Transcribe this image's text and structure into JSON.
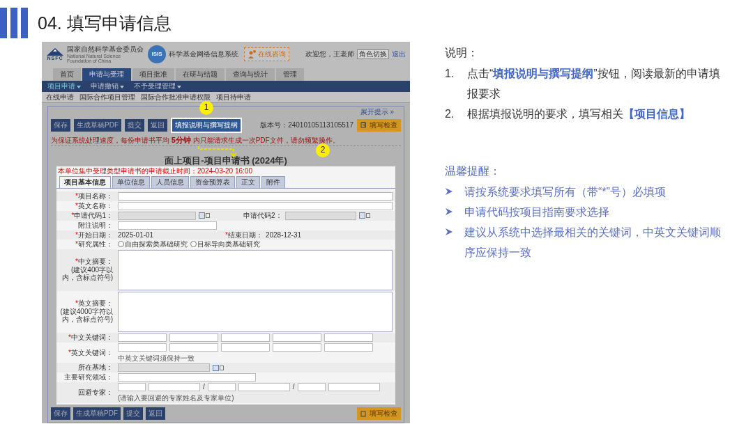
{
  "slide": {
    "title": "04. 填写申请信息"
  },
  "screenshot": {
    "header": {
      "logo_letters": "NSFC",
      "org_name": "国家自然科学基金委员会",
      "org_name_en": "National Natural Science Foundation of China",
      "system_badge": "ISIS",
      "system_name": "科学基金网络信息系统",
      "consult_button": "在线咨询",
      "welcome": "欢迎您，王老师",
      "role_select": "角色切换",
      "logout": "退出"
    },
    "main_tabs": [
      {
        "label": "首页",
        "selected": false
      },
      {
        "label": "申请与受理",
        "selected": true
      },
      {
        "label": "项目批准",
        "selected": false
      },
      {
        "label": "在研与结题",
        "selected": false
      },
      {
        "label": "查询与统计",
        "selected": false
      },
      {
        "label": "管理",
        "selected": false
      }
    ],
    "menu": [
      {
        "label": "项目申请",
        "selected": true
      },
      {
        "label": "申请撤销",
        "selected": false
      },
      {
        "label": "不予受理管理",
        "selected": false
      }
    ],
    "submenu": [
      "在线申请",
      "国际合作项目管理",
      "国际合作批准申请权限",
      "项目待申请"
    ],
    "hint_toggle": "展开提示 »",
    "toolbar": {
      "buttons": [
        {
          "label": "保存",
          "highlighted": false
        },
        {
          "label": "生成草稿PDF",
          "highlighted": false
        },
        {
          "label": "提交",
          "highlighted": false
        },
        {
          "label": "返回",
          "highlighted": false
        },
        {
          "label": "填报说明与撰写提纲",
          "highlighted": true
        }
      ],
      "version": "版本号：24010105113105517",
      "check_button": "填写检查"
    },
    "warning": "为保证系统处理速度，每份申请书平均 **5分钟** 内只能请求生成一次PDF文件，请勿频繁操作。",
    "form_title": "面上项目-项目申请书 (2024年)",
    "deadline": "本单位集中受理类型申请书的申请截止时间：2024-03-20 16:00",
    "form_tabs": [
      {
        "label": "项目基本信息",
        "selected": true
      },
      {
        "label": "单位信息",
        "selected": false
      },
      {
        "label": "人员信息",
        "selected": false
      },
      {
        "label": "资金预算表",
        "selected": false
      },
      {
        "label": "正文",
        "selected": false
      },
      {
        "label": "附件",
        "selected": false
      }
    ],
    "fields": [
      {
        "kind": "text",
        "mark": "*",
        "label": "项目名称："
      },
      {
        "kind": "text",
        "mark": "*",
        "label": "英文名称："
      },
      {
        "kind": "code_pair",
        "mark": "*",
        "label": "申请代码1：",
        "label2": "申请代码2："
      },
      {
        "kind": "select",
        "label": "附注说明："
      },
      {
        "kind": "date_pair",
        "mark": "*",
        "label": "开始日期：",
        "value": "2025-01-01",
        "mark2": "*",
        "label2": "结束日期：",
        "value2": "2028-12-31"
      },
      {
        "kind": "radio",
        "mark": "*",
        "label": "研究属性：",
        "options": [
          {
            "label": "自由探索类基础研究",
            "selected": false
          },
          {
            "label": "目标导向类基础研究",
            "selected": false
          }
        ]
      },
      {
        "kind": "textarea",
        "mark": "*",
        "label": "中文摘要：",
        "note": "(建议400字以内，含标点符号)"
      },
      {
        "kind": "textarea",
        "mark": "*",
        "label": "英文摘要：",
        "note": "(建议4000字符以内，含标点符号)"
      },
      {
        "kind": "keywords",
        "mark": "*",
        "label": "中文关键词："
      },
      {
        "kind": "keywords",
        "mark": "*",
        "label": "英文关键词：",
        "note": "中英文关键词须保持一致"
      },
      {
        "kind": "picker",
        "label": "所在基地："
      },
      {
        "kind": "short_text",
        "label": "主要研究领域："
      },
      {
        "kind": "experts",
        "label": "回避专家：",
        "separator": "/",
        "note": "(请输入要回避的专家姓名及专家单位)"
      }
    ],
    "bottom_buttons": [
      "保存",
      "生成草稿PDF",
      "提交",
      "返回"
    ],
    "bottom_check_button": "填写检查",
    "callouts": [
      "1",
      "2"
    ]
  },
  "notes": {
    "title": "说明：",
    "steps": [
      {
        "number": "1.",
        "text": "点击“**填报说明与撰写提纲**”按钮，阅读最新的申请填报要求"
      },
      {
        "number": "2.",
        "text": "根据填报说明的要求，填写相关**【项目信息】**"
      }
    ]
  },
  "tips": {
    "title": "温馨提醒：",
    "items": [
      "请按系统要求填写所有（带“*”号）必填项",
      "申请代码按项目指南要求选择",
      "建议从系统中选择最相关的关键词，中英文关键词顺序应保持一致"
    ]
  }
}
